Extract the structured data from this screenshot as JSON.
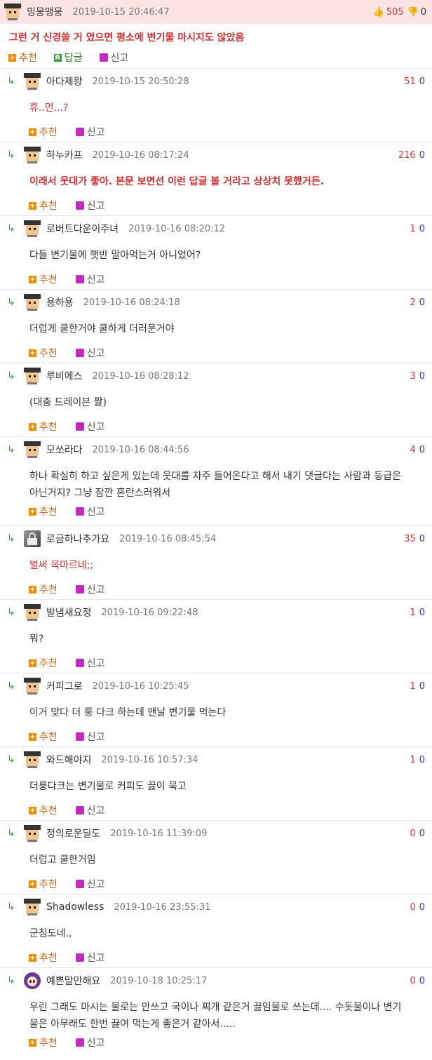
{
  "top": {
    "nick": "밍뭉맹뭉",
    "date": "2019-10-15 20:46:47",
    "up": "505",
    "down": "0",
    "body": "그런 거 신경쓸 거 였으면 평소에 변기물 마시지도 않았음",
    "recommend": "추천",
    "reply": "답글",
    "report": "신고"
  },
  "labels": {
    "recommend": "추천",
    "report": "신고"
  },
  "comments": [
    {
      "nick": "아다제왕",
      "date": "2019-10-15 20:50:28",
      "up": "51",
      "down": "0",
      "body": "휴..먼...?",
      "style": "red"
    },
    {
      "nick": "하누카프",
      "date": "2019-10-16 08:17:24",
      "up": "216",
      "down": "0",
      "body": "이래서 웃대가 좋아. 본문 보면선 이런 답글 볼 거라고 상상치 못했거든.",
      "style": "redbold"
    },
    {
      "nick": "로버트다운이주녀",
      "date": "2019-10-16 08:20:12",
      "up": "1",
      "down": "0",
      "body": "다들 변기물에 햇반 말아먹는거 아니었어?",
      "style": ""
    },
    {
      "nick": "용하용",
      "date": "2019-10-16 08:24:18",
      "up": "2",
      "down": "0",
      "body": "더럽게 쿨한거야 쿨하게 더러운거야",
      "style": ""
    },
    {
      "nick": "루비에스",
      "date": "2019-10-16 08:28:12",
      "up": "3",
      "down": "0",
      "body": "(대충 드레이븐 짤)",
      "style": ""
    },
    {
      "nick": "모쏘라다",
      "date": "2019-10-16 08:44:56",
      "up": "4",
      "down": "0",
      "body": "하나 확실히 하고 싶은게 있는데 웃대를 자주 들어온다고 해서 내기 댓글다는 사람과 등급은 아닌거지? 그냥 잠깐 혼란스러워서",
      "style": ""
    },
    {
      "nick": "로금하나추가요",
      "date": "2019-10-16 08:45:54",
      "up": "35",
      "down": "0",
      "body": "벌써 목마르네;;",
      "style": "red",
      "avatar": "lock"
    },
    {
      "nick": "발냄새요정",
      "date": "2019-10-16 09:22:48",
      "up": "1",
      "down": "0",
      "body": "뭐?",
      "style": ""
    },
    {
      "nick": "커피그로",
      "date": "2019-10-16 10:25:45",
      "up": "1",
      "down": "0",
      "body": "이거 맞다 더 룽 다크 하는데 맨날 변기물 먹는다",
      "style": ""
    },
    {
      "nick": "와드해야지",
      "date": "2019-10-16 10:57:34",
      "up": "1",
      "down": "0",
      "body": "더룽다크는 변기물로 커피도 끓이 묵고",
      "style": ""
    },
    {
      "nick": "정의로운딜도",
      "date": "2019-10-16 11:39:09",
      "up": "0",
      "down": "0",
      "body": "더럽고 쿨한거임",
      "style": ""
    },
    {
      "nick": "Shadowless",
      "date": "2019-10-16 23:55:31",
      "up": "0",
      "down": "0",
      "body": "군침도네.,",
      "style": ""
    },
    {
      "nick": "예쁜말만해요",
      "date": "2019-10-18 10:25:17",
      "up": "0",
      "down": "0",
      "body": "우린 그래도 마시는 물로는 안쓰고 국이나 찌개 같은거 끓임물로 쓰는데.... 수돗물이나 변기물은 아무래도 한번 끓여 먹는게 좋은거 같아서.....",
      "style": "",
      "avatar": "girl"
    }
  ]
}
